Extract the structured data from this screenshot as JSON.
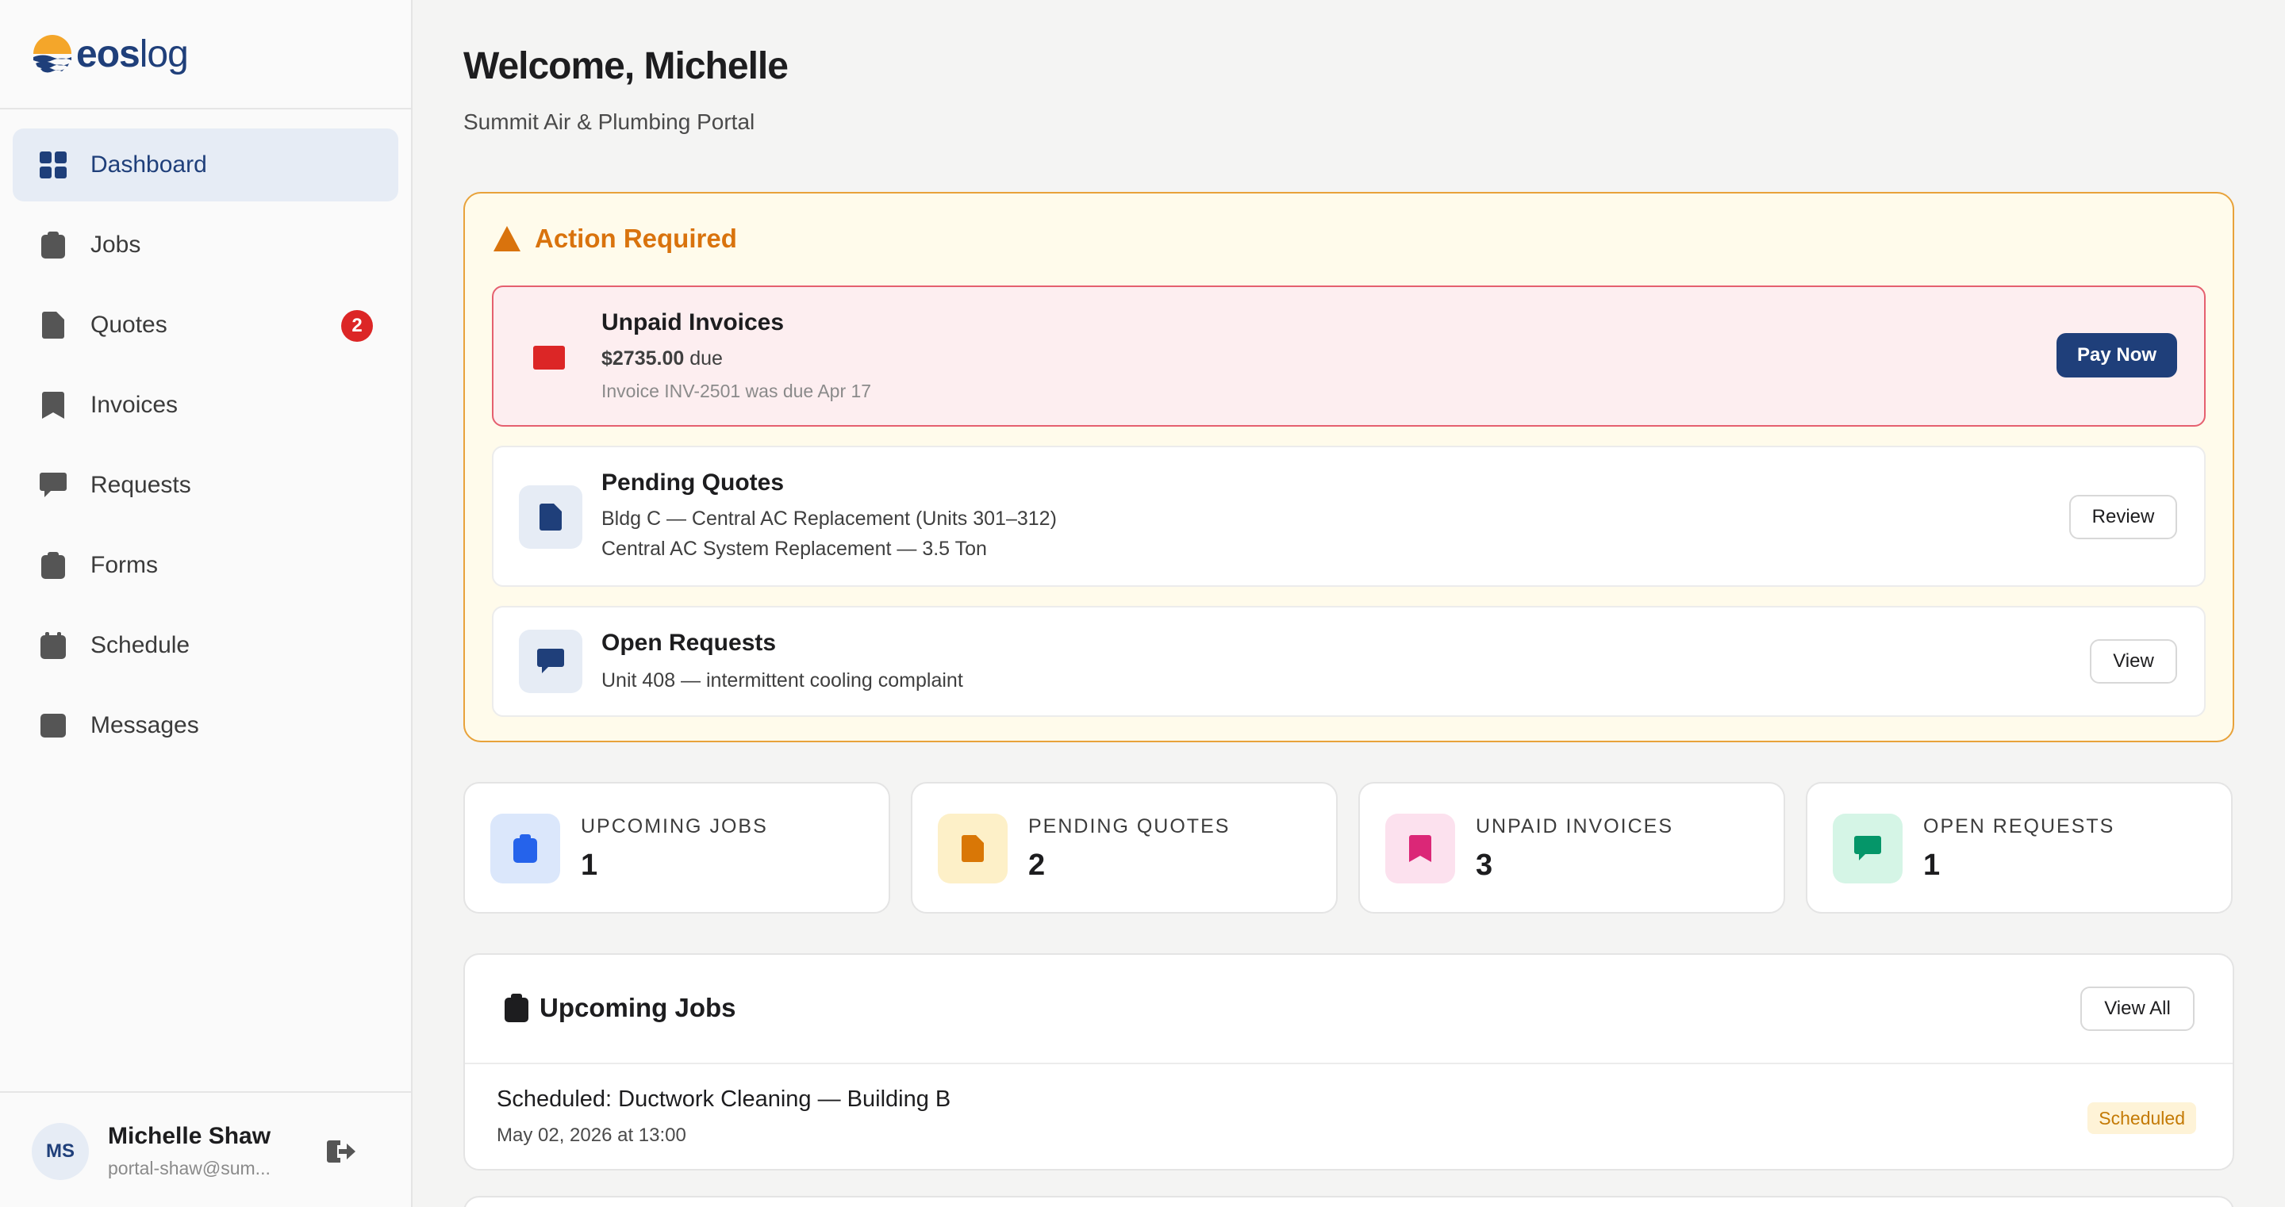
{
  "brand": {
    "name_bold": "eos",
    "name_light": "log"
  },
  "sidebar": {
    "items": [
      {
        "label": "Dashboard",
        "icon": "grid-icon",
        "active": true
      },
      {
        "label": "Jobs",
        "icon": "clipboard-icon"
      },
      {
        "label": "Quotes",
        "icon": "file-icon",
        "badge": "2"
      },
      {
        "label": "Invoices",
        "icon": "receipt-icon"
      },
      {
        "label": "Requests",
        "icon": "chat-icon"
      },
      {
        "label": "Forms",
        "icon": "clipboard-icon"
      },
      {
        "label": "Schedule",
        "icon": "calendar-icon"
      },
      {
        "label": "Messages",
        "icon": "message-icon"
      }
    ]
  },
  "user": {
    "initials": "MS",
    "name": "Michelle Shaw",
    "email": "portal-shaw@sum..."
  },
  "header": {
    "title": "Welcome, Michelle",
    "subtitle": "Summit Air & Plumbing Portal"
  },
  "action_required": {
    "title": "Action Required",
    "unpaid": {
      "title": "Unpaid Invoices",
      "amount": "$2735.00",
      "amount_suffix": " due",
      "note": "Invoice INV-2501 was due Apr 17",
      "button": "Pay Now"
    },
    "quotes": {
      "title": "Pending Quotes",
      "line1": "Bldg C — Central AC Replacement (Units 301–312)",
      "line2": "Central AC System Replacement — 3.5 Ton",
      "button": "Review"
    },
    "requests": {
      "title": "Open Requests",
      "line1": "Unit 408 — intermittent cooling complaint",
      "button": "View"
    }
  },
  "stats": [
    {
      "label": "UPCOMING JOBS",
      "value": "1",
      "color": "#2563eb",
      "bg": "#dbe7fb"
    },
    {
      "label": "PENDING QUOTES",
      "value": "2",
      "color": "#d97706",
      "bg": "#fdf0c8"
    },
    {
      "label": "UNPAID INVOICES",
      "value": "3",
      "color": "#db2777",
      "bg": "#fce1ee"
    },
    {
      "label": "OPEN REQUESTS",
      "value": "1",
      "color": "#059669",
      "bg": "#d5f5e6"
    }
  ],
  "upcoming_jobs": {
    "title": "Upcoming Jobs",
    "view_all": "View All",
    "jobs": [
      {
        "title": "Scheduled: Ductwork Cleaning — Building B",
        "date": "May 02, 2026 at 13:00",
        "status": "Scheduled"
      }
    ]
  }
}
